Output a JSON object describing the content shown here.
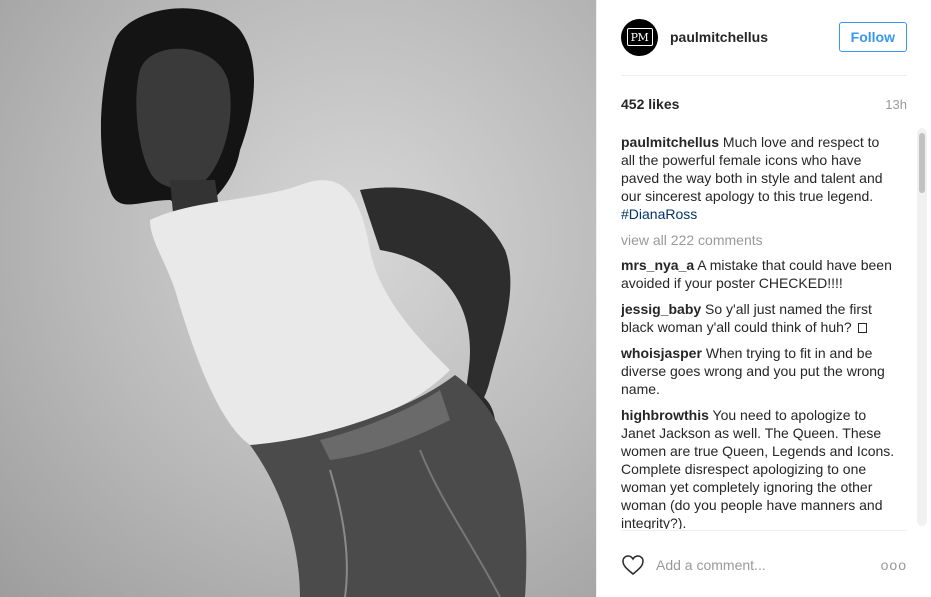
{
  "post": {
    "username": "paulmitchellus",
    "avatar_text": "PM",
    "follow_label": "Follow",
    "likes": "452 likes",
    "time_ago": "13h",
    "caption_user": "paulmitchellus",
    "caption_text": "Much love and respect to all the powerful female icons who have paved the way both in style and talent and our sincerest apology to this true legend.",
    "caption_hashtag": "#DianaRoss",
    "view_all": "view all 222 comments"
  },
  "comments": [
    {
      "user": "mrs_nya_a",
      "text": "A mistake that could have been avoided if your poster CHECKED!!!!"
    },
    {
      "user": "jessig_baby",
      "text": "So y'all just named the first black woman y'all could think of huh?"
    },
    {
      "user": "whoisjasper",
      "text": "When trying to fit in and be diverse goes wrong and you put the wrong name."
    },
    {
      "user": "highbrowthis",
      "text": "You need to apologize to Janet Jackson as well. The Queen. These women are true Queen, Legends and Icons. Complete disrespect apologizing to one woman yet completely ignoring the other woman (do you people have manners and integrity?)."
    }
  ],
  "footer": {
    "add_comment_placeholder": "Add a comment...",
    "more_label": "ooo"
  },
  "colors": {
    "accent": "#3897f0",
    "hashtag": "#003569",
    "muted": "#999999"
  }
}
